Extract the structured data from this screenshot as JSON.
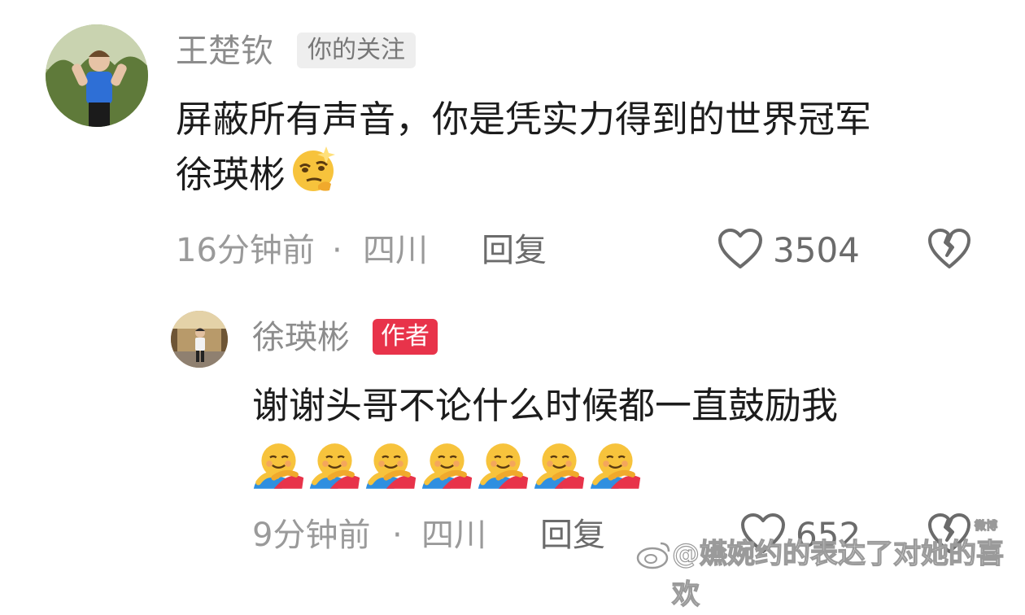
{
  "comment": {
    "username": "王楚钦",
    "tag": "你的关注",
    "text_line1": "屏蔽所有声音，你是凭实力得到的世界冠军",
    "text_line2": "徐瑛彬",
    "emoji": "smirk-thinking-emoji",
    "time": "16分钟前",
    "location": "四川",
    "separator": "·",
    "reply_label": "回复",
    "like_count": "3504"
  },
  "reply": {
    "username": "徐瑛彬",
    "tag": "作者",
    "text": "谢谢头哥不论什么时候都一直鼓励我",
    "emoji": "hugging-face-emoji",
    "emoji_count": 7,
    "time": "9分钟前",
    "location": "四川",
    "separator": "·",
    "reply_label": "回复",
    "like_count": "652"
  },
  "watermark": {
    "text": "@嬿婉约的表达了对她的喜欢",
    "small_text": "微博"
  },
  "colors": {
    "author_tag": "#e8334a",
    "follow_tag_bg": "#eeeeee",
    "name": "#8c8c8c",
    "meta": "#9a9a9a"
  }
}
